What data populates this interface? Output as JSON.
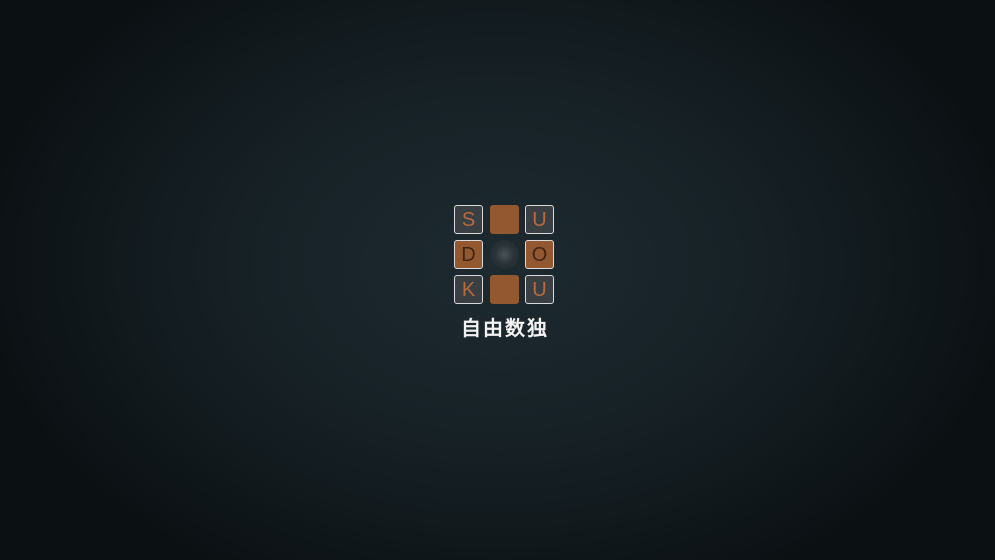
{
  "logo": {
    "tiles": [
      {
        "text": "S",
        "style": "outlined"
      },
      {
        "text": "",
        "style": "block"
      },
      {
        "text": "U",
        "style": "outlined"
      },
      {
        "text": "D",
        "style": "filled"
      },
      {
        "text": "",
        "style": "center"
      },
      {
        "text": "O",
        "style": "filled"
      },
      {
        "text": "K",
        "style": "outlined"
      },
      {
        "text": "",
        "style": "block"
      },
      {
        "text": "U",
        "style": "outlined"
      }
    ]
  },
  "subtitle": "自由数独",
  "colors": {
    "background": "#172227",
    "tile_brown": "#93582f",
    "letter_brown": "#b86a3c",
    "tile_border": "#d8dadc"
  }
}
